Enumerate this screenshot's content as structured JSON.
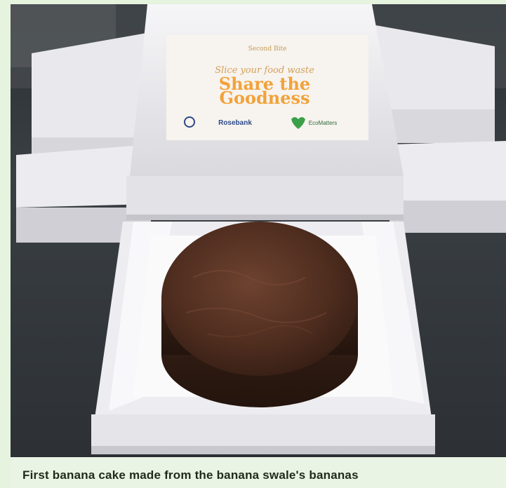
{
  "caption": {
    "text": "First banana cake made from the banana swale's bananas"
  },
  "label": {
    "brand": "Second Bite",
    "tagline": "Slice your food waste",
    "headline_line1": "Share the",
    "headline_line2": "Goodness",
    "sponsors": [
      "Rosebank",
      "EcoMatters"
    ]
  },
  "colors": {
    "frame": "#e6f3df",
    "headline": "#f2a23a",
    "box": "#f1f1f3",
    "cake": "#4a2a1c"
  }
}
